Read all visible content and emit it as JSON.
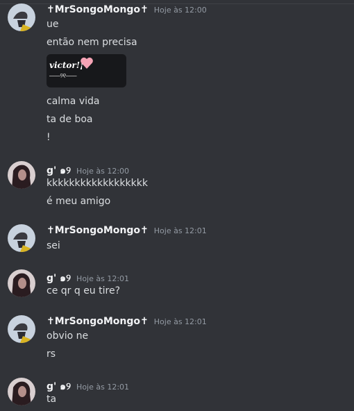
{
  "users": {
    "mrsongo": {
      "name": "✝MrSongoMongo✝"
    },
    "g": {
      "name": "g' ๑୨"
    }
  },
  "messages": [
    {
      "timestamp": "Hoje às 12:00",
      "lines": [
        "ue",
        "então nem precisa",
        "calma vida",
        "ta de boa",
        "!"
      ]
    },
    {
      "timestamp": "Hoje às 12:00",
      "lines": [
        "kkkkkkkkkkkkkkkkkk",
        "é meu amigo"
      ]
    },
    {
      "timestamp": "Hoje às 12:01",
      "lines": [
        "sei"
      ]
    },
    {
      "timestamp": "Hoje às 12:01",
      "lines": [
        "ce qr q eu tire?"
      ]
    },
    {
      "timestamp": "Hoje às 12:01",
      "lines": [
        "obvio ne",
        "rs"
      ]
    },
    {
      "timestamp": "Hoje às 12:01",
      "lines": [
        "ta"
      ]
    }
  ],
  "embed": {
    "title": "victor!¡",
    "subtitle": "———୨୧———",
    "heart_color": "#f5a3b5"
  },
  "icons": {
    "heart": "heart-icon"
  }
}
